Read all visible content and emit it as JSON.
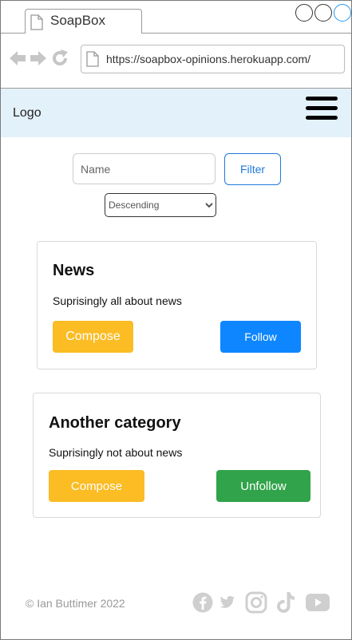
{
  "browser": {
    "tab_title": "SoapBox",
    "url": "https://soapbox-opinions.herokuapp.com/"
  },
  "header": {
    "logo": "Logo"
  },
  "filter": {
    "name_placeholder": "Name",
    "filter_label": "Filter",
    "sort_selected": "Descending"
  },
  "categories": [
    {
      "title": "News",
      "description": "Suprisingly all about news",
      "compose_label": "Compose",
      "action_label": "Follow"
    },
    {
      "title": "Another category",
      "description": "Suprisingly not about news",
      "compose_label": "Compose",
      "action_label": "Unfollow"
    }
  ],
  "footer": {
    "copyright": "© Ian Buttimer 2022",
    "social_icons": [
      "facebook-icon",
      "twitter-icon",
      "instagram-icon",
      "tiktok-icon",
      "youtube-icon"
    ]
  },
  "colors": {
    "header_bg": "#e3f1fb",
    "compose": "#fbbc24",
    "follow": "#0d86ff",
    "unfollow": "#31a34a",
    "filter_accent": "#1f7ad9"
  }
}
